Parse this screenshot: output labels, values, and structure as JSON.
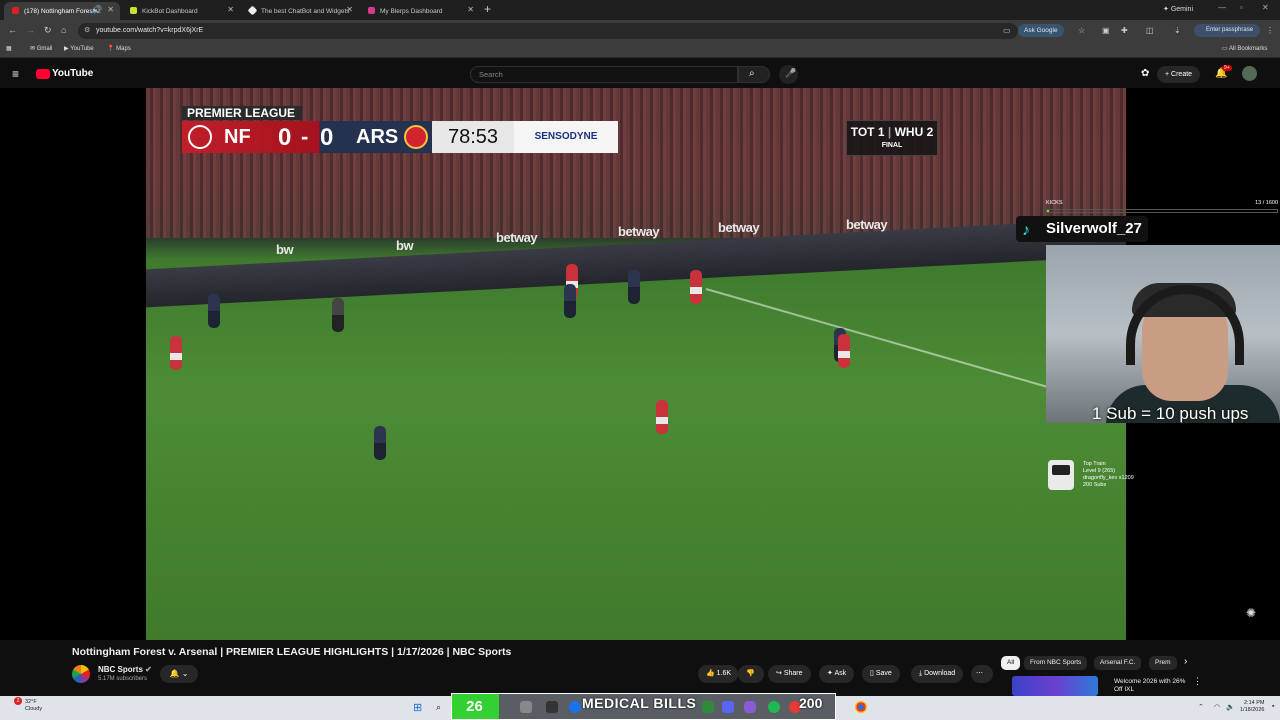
{
  "browser": {
    "tabs": [
      {
        "title": "(178) Nottingham Forest v.",
        "active": true
      },
      {
        "title": "KickBot Dashboard",
        "active": false
      },
      {
        "title": "The best ChatBot and Widgets",
        "active": false
      },
      {
        "title": "My Blerps Dashboard",
        "active": false
      }
    ],
    "gemini_label": "Gemini",
    "url": "youtube.com/watch?v=krpdX6jXrE",
    "ask_google": "Ask Google",
    "passphrase": "Enter passphrase",
    "bookmarks": [
      "Gmail",
      "YouTube",
      "Maps"
    ],
    "all_bookmarks": "All Bookmarks"
  },
  "youtube": {
    "logo": "YouTube",
    "search_placeholder": "Search",
    "create_label": "Create",
    "notif_count": "9+"
  },
  "video": {
    "scoreboard": {
      "league": "PREMIER LEAGUE",
      "home": "NF",
      "home_score": "0",
      "sep": "-",
      "away_score": "0",
      "away": "ARS",
      "clock": "78:53",
      "sponsor": "SENSODYNE"
    },
    "other_score": {
      "home": "TOT",
      "home_score": "1",
      "away": "WHU",
      "away_score": "2",
      "status": "FINAL"
    },
    "boards": [
      "betway",
      "betway",
      "betway",
      "betway",
      "betway",
      "bw",
      "bw"
    ]
  },
  "overlay": {
    "kicks_label": "KICKS",
    "kicks_count": "13 / 1600",
    "tiktok_user": "Silverwolf_27",
    "sub_text": "1 Sub = 10 push ups",
    "train_info": [
      "Top Train",
      "Level 9 (265)",
      "dragonfly_kev x1209",
      "200 Subs"
    ]
  },
  "below": {
    "title": "Nottingham Forest v. Arsenal | PREMIER LEAGUE HIGHLIGHTS | 1/17/2026 | NBC Sports",
    "channel": "NBC Sports",
    "subscribers": "5.17M subscribers",
    "likes": "1.6K",
    "share": "Share",
    "ask": "Ask",
    "save": "Save",
    "download": "Download",
    "chips": [
      "All",
      "From NBC Sports",
      "Arsenal F.C.",
      "Prem"
    ],
    "ad_title": "Welcome 2026 with 26% Off IXL"
  },
  "taskbar": {
    "weather_temp": "32°F",
    "weather_desc": "Cloudy",
    "weather_badge": "2",
    "counter_left": "26",
    "counter_text": "MEDICAL BILLS",
    "counter_right": "200",
    "time": "2:14 PM",
    "date": "1/18/2026"
  }
}
